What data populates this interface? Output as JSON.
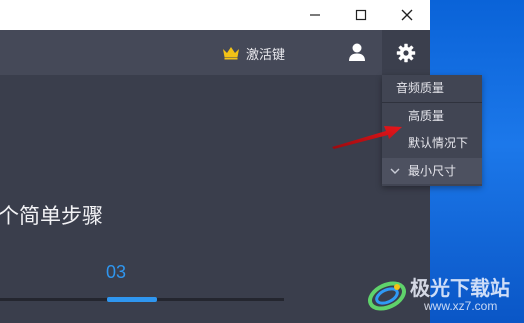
{
  "window": {
    "buttons": [
      "minimize",
      "maximize",
      "close"
    ],
    "minimize_glyph": "—",
    "maximize_glyph": "☐",
    "close_glyph": "✕"
  },
  "toolbar": {
    "activate_label": "激活键",
    "activate_icon": "crown-icon",
    "user_icon": "user-icon",
    "settings_icon": "gear-icon",
    "accent_color": "#f3c316"
  },
  "content": {
    "title": "个简单步骤",
    "step_number": "03",
    "accent_color": "#2f96ef"
  },
  "quality_menu": {
    "header": "音频质量",
    "items": [
      {
        "label": "高质量",
        "selected": false
      },
      {
        "label": "默认情况下",
        "selected": false
      },
      {
        "label": "最小尺寸",
        "selected": true
      }
    ]
  },
  "annotation": {
    "arrow_color": "#e0141a"
  },
  "watermark": {
    "brand": "极光下载站",
    "url": "www.xz7.com"
  }
}
